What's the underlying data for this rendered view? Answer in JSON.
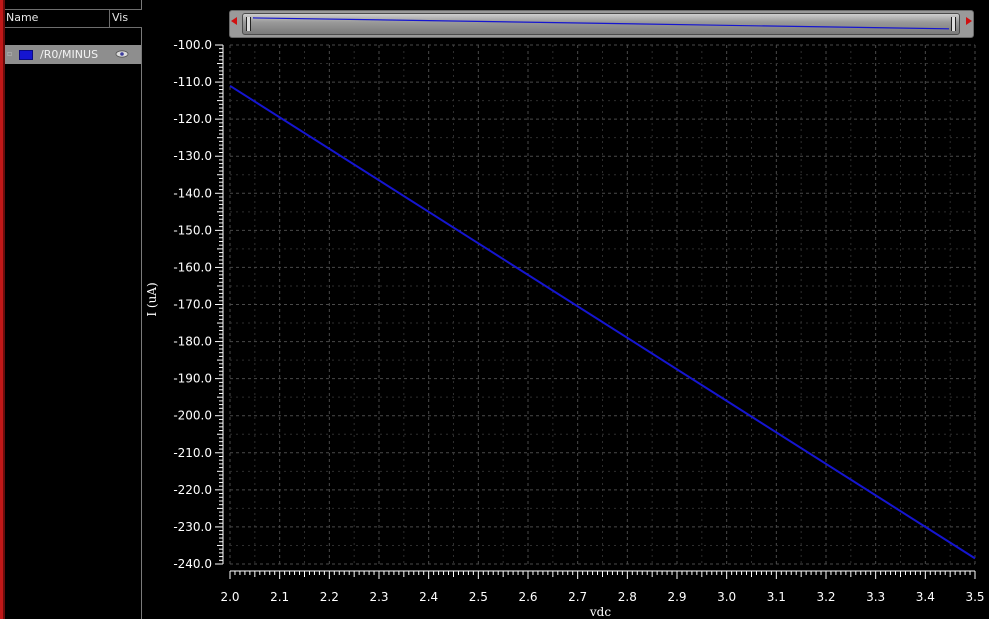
{
  "panel": {
    "title": "",
    "header_name": "Name",
    "header_vis": "Vis",
    "signals": [
      {
        "label": "/R0/MINUS",
        "color": "#1515d0",
        "visible": true
      }
    ]
  },
  "icons": {
    "expander": "tree-expander-icon",
    "visibility": "eye-icon",
    "scroll_left": "arrow-left-icon",
    "scroll_right": "arrow-right-icon"
  },
  "colors": {
    "background": "#000000",
    "grid": "#4a4a4a",
    "trace": "#1515d0",
    "axis": "#ffffff",
    "panel_row": "#8e8e8e",
    "accent_border": "#c01818"
  },
  "chart_data": {
    "type": "line",
    "title": "",
    "xlabel": "vdc",
    "ylabel": "I (uA)",
    "xlim": [
      2.0,
      3.5
    ],
    "ylim": [
      -240.0,
      -100.0
    ],
    "grid": true,
    "x_ticks": [
      "2.0",
      "2.1",
      "2.2",
      "2.3",
      "2.4",
      "2.5",
      "2.6",
      "2.7",
      "2.8",
      "2.9",
      "3.0",
      "3.1",
      "3.2",
      "3.3",
      "3.4",
      "3.5"
    ],
    "y_ticks": [
      "-100.0",
      "-110.0",
      "-120.0",
      "-130.0",
      "-140.0",
      "-150.0",
      "-160.0",
      "-170.0",
      "-180.0",
      "-190.0",
      "-200.0",
      "-210.0",
      "-220.0",
      "-230.0",
      "-240.0"
    ],
    "series": [
      {
        "name": "/R0/MINUS",
        "color": "#1515d0",
        "x": [
          2.0,
          2.5,
          3.0,
          3.5
        ],
        "y": [
          -111.0,
          -153.5,
          -196.0,
          -238.5
        ]
      }
    ]
  }
}
